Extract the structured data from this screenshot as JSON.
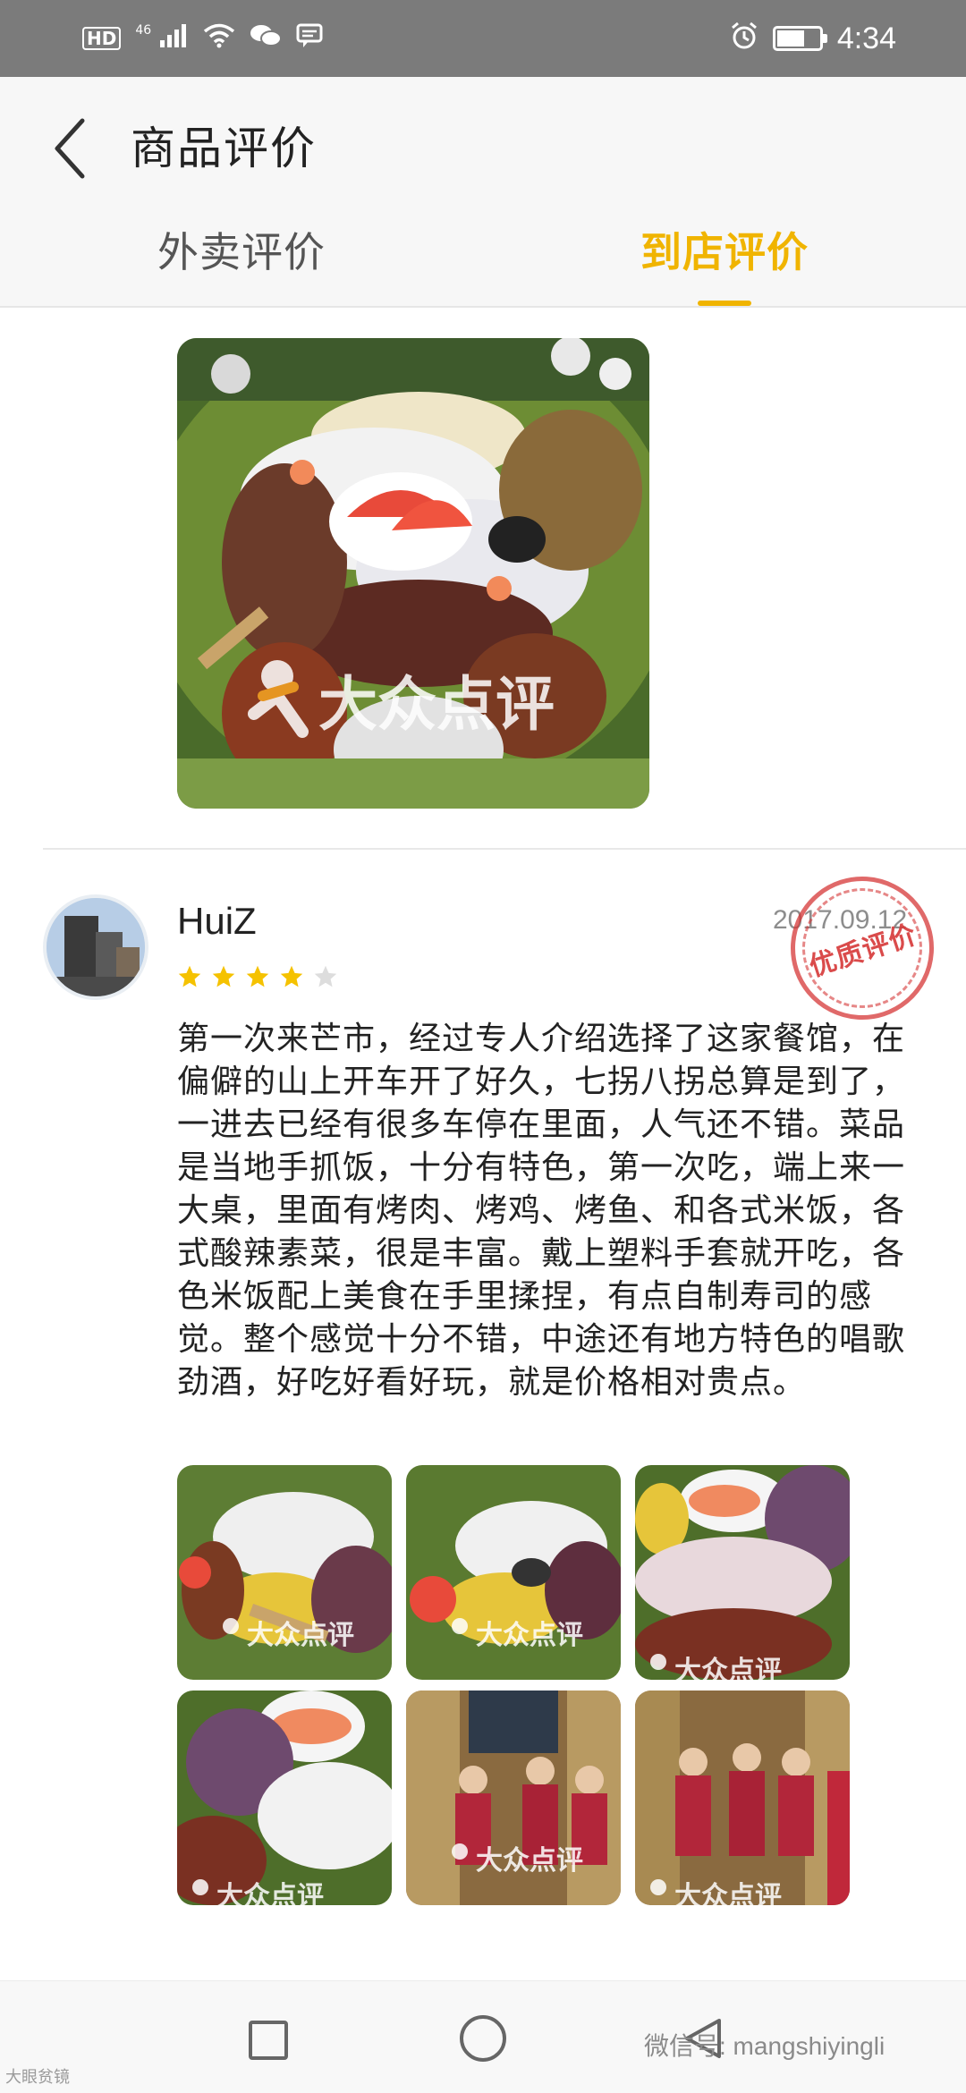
{
  "status_bar": {
    "time": "4:34",
    "network_label": "46",
    "hd_label": "HD"
  },
  "header": {
    "title": "商品评价",
    "tabs": [
      {
        "label": "外卖评价",
        "active": false
      },
      {
        "label": "到店评价",
        "active": true
      }
    ]
  },
  "colors": {
    "accent": "#f0b400",
    "star_filled": "#f5c200",
    "star_empty": "#dddddd",
    "badge": "#d63737"
  },
  "photo_watermark": "大众点评",
  "review": {
    "username": "HuiZ",
    "date": "2017.09.12",
    "rating": 4,
    "rating_max": 5,
    "quality_badge": "优质评价",
    "text": "第一次来芒市，经过专人介绍选择了这家餐馆，在偏僻的山上开车开了好久，七拐八拐总算是到了，一进去已经有很多车停在里面，人气还不错。菜品是当地手抓饭，十分有特色，第一次吃，端上来一大桌，里面有烤肉、烤鸡、烤鱼、和各式米饭，各式酸辣素菜，很是丰富。戴上塑料手套就开吃，各色米饭配上美食在手里揉捏，有点自制寿司的感觉。整个感觉十分不错，中途还有地方特色的唱歌劲酒，好吃好看好玩，就是价格相对贵点。",
    "photo_count": 6
  },
  "nav_bar": {
    "icons": [
      "square-icon",
      "circle-home-icon",
      "triangle-back-icon"
    ]
  },
  "watermarks": {
    "wechat": "微信号: mangshiyingli",
    "corner": "大眼贫镜"
  }
}
